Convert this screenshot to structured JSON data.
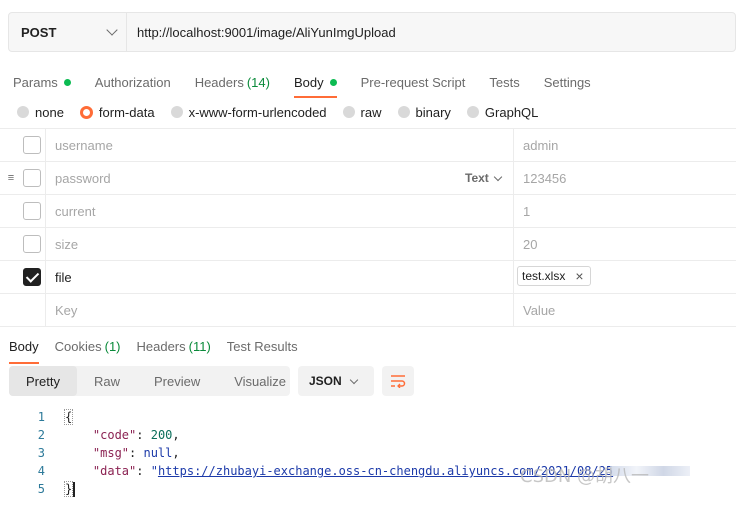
{
  "request": {
    "method": "POST",
    "url": "http://localhost:9001/image/AliYunImgUpload"
  },
  "request_tabs": [
    {
      "label": "Params",
      "dot": true
    },
    {
      "label": "Authorization"
    },
    {
      "label": "Headers",
      "count": "(14)"
    },
    {
      "label": "Body",
      "dot": true,
      "active": true
    },
    {
      "label": "Pre-request Script"
    },
    {
      "label": "Tests"
    },
    {
      "label": "Settings"
    }
  ],
  "body_types": [
    "none",
    "form-data",
    "x-www-form-urlencoded",
    "raw",
    "binary",
    "GraphQL"
  ],
  "body_type_selected": "form-data",
  "form_rows": [
    {
      "key": "username",
      "value": "admin",
      "checked": false
    },
    {
      "key": "password",
      "value": "123456",
      "checked": false,
      "type": "Text"
    },
    {
      "key": "current",
      "value": "1",
      "checked": false
    },
    {
      "key": "size",
      "value": "20",
      "checked": false
    },
    {
      "key": "file",
      "value": "test.xlsx",
      "checked": true,
      "is_file": true
    },
    {
      "key_placeholder": "Key",
      "value_placeholder": "Value"
    }
  ],
  "response_tabs": [
    {
      "label": "Body",
      "active": true
    },
    {
      "label": "Cookies",
      "count": "(1)"
    },
    {
      "label": "Headers",
      "count": "(11)"
    },
    {
      "label": "Test Results"
    }
  ],
  "view_modes": [
    "Pretty",
    "Raw",
    "Preview",
    "Visualize"
  ],
  "view_mode_selected": "Pretty",
  "format": "JSON",
  "code_lines": [
    "1",
    "2",
    "3",
    "4",
    "5"
  ],
  "response_json": {
    "open": "{",
    "code_key": "\"code\"",
    "code_val": "200",
    "msg_key": "\"msg\"",
    "msg_val": "null",
    "data_key": "\"data\"",
    "data_val": "https://zhubayi-exchange.oss-cn-chengdu.aliyuncs.com/2021/08/25",
    "close": "}"
  },
  "watermark": "CSDN @胡八一",
  "colors": {
    "accent": "#ff6c37",
    "green_dot": "#0cbb52",
    "count_green": "#0a8a3a"
  }
}
